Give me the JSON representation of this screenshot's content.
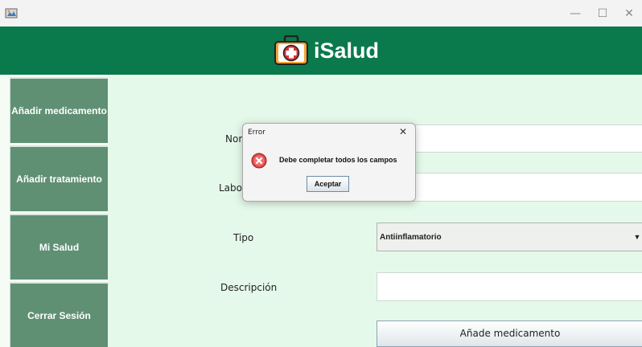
{
  "window": {
    "minimize_glyph": "—",
    "maximize_glyph": "☐",
    "close_glyph": "✕"
  },
  "header": {
    "app_name": "iSalud",
    "logo_icon": "first-aid-kit-icon",
    "colors": {
      "brand_green": "#0a7a4c",
      "logo_red": "#d9333b",
      "logo_orange": "#f3a43b"
    }
  },
  "sidebar": {
    "items": [
      {
        "label": "Añadir medicamento"
      },
      {
        "label": "Añadir tratamiento"
      },
      {
        "label": "Mi Salud"
      },
      {
        "label": "Cerrar Sesión"
      }
    ],
    "colors": {
      "button_bg": "#609074"
    }
  },
  "form": {
    "name_label": "Nom",
    "lab_label": "Labor",
    "type_label": "Tipo",
    "type_value": "Antiinflamatorio",
    "description_label": "Descripción",
    "submit_label": "Añade medicamento"
  },
  "dialog": {
    "title": "Error",
    "close_glyph": "✕",
    "message": "Debe completar todos los campos",
    "ok_label": "Aceptar",
    "icon": "error-icon"
  }
}
